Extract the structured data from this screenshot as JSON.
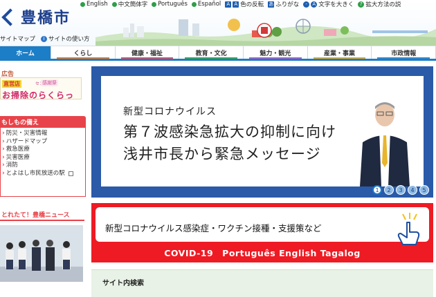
{
  "header": {
    "logo_text": "豊橋市",
    "utility_links": [
      {
        "label": "English"
      },
      {
        "label": "中文簡体字"
      },
      {
        "label": "Português"
      },
      {
        "label": "Español"
      }
    ],
    "contrast_label": "色の反転",
    "furigana_label": "ふりがな",
    "text_size_label": "文字を大きく",
    "help_label": "拡大方法の説",
    "sitemap_label": "サイトマップ",
    "howto_label": "サイトの使い方"
  },
  "nav": {
    "items": [
      {
        "label": "ホーム"
      },
      {
        "label": "くらし"
      },
      {
        "label": "健康・福祉"
      },
      {
        "label": "教育・文化"
      },
      {
        "label": "魅力・観光"
      },
      {
        "label": "産業・事業"
      },
      {
        "label": "市政情報"
      }
    ]
  },
  "sidebar": {
    "ad_label": "広告",
    "ad_banner": {
      "tag": "直営店",
      "small1": "センター",
      "tag2": "感謝祭",
      "headline": "お掃除のらくらっく"
    },
    "prep_title": "もしもの備え",
    "prep_items": [
      {
        "label": "防災・災害情報"
      },
      {
        "label": "ハザードマップ"
      },
      {
        "label": "救急医療"
      },
      {
        "label": "災害医療"
      },
      {
        "label": "消防"
      },
      {
        "label": "とよはし市民放送の駅"
      }
    ],
    "news_title": "とれたて！豊橋ニュース"
  },
  "hero": {
    "subtitle": "新型コロナウイルス",
    "line1": "第７波感染急拡大の抑制に向け",
    "line2": "浅井市長から緊急メッセージ",
    "slides": [
      "1",
      "2",
      "3",
      "4",
      "5"
    ],
    "active_slide": 1
  },
  "covid_banner": {
    "text": "新型コロナウイルス感染症・ワクチン接種・支援策など",
    "langs": "COVID-19　Português English Tagalog"
  },
  "search": {
    "title": "サイト内検索"
  },
  "colors": {
    "nav_active": "#1c7ec6",
    "hero_frame": "#2a5aa8",
    "covid_red": "#ee1b24",
    "prep_red": "#e8434a"
  }
}
